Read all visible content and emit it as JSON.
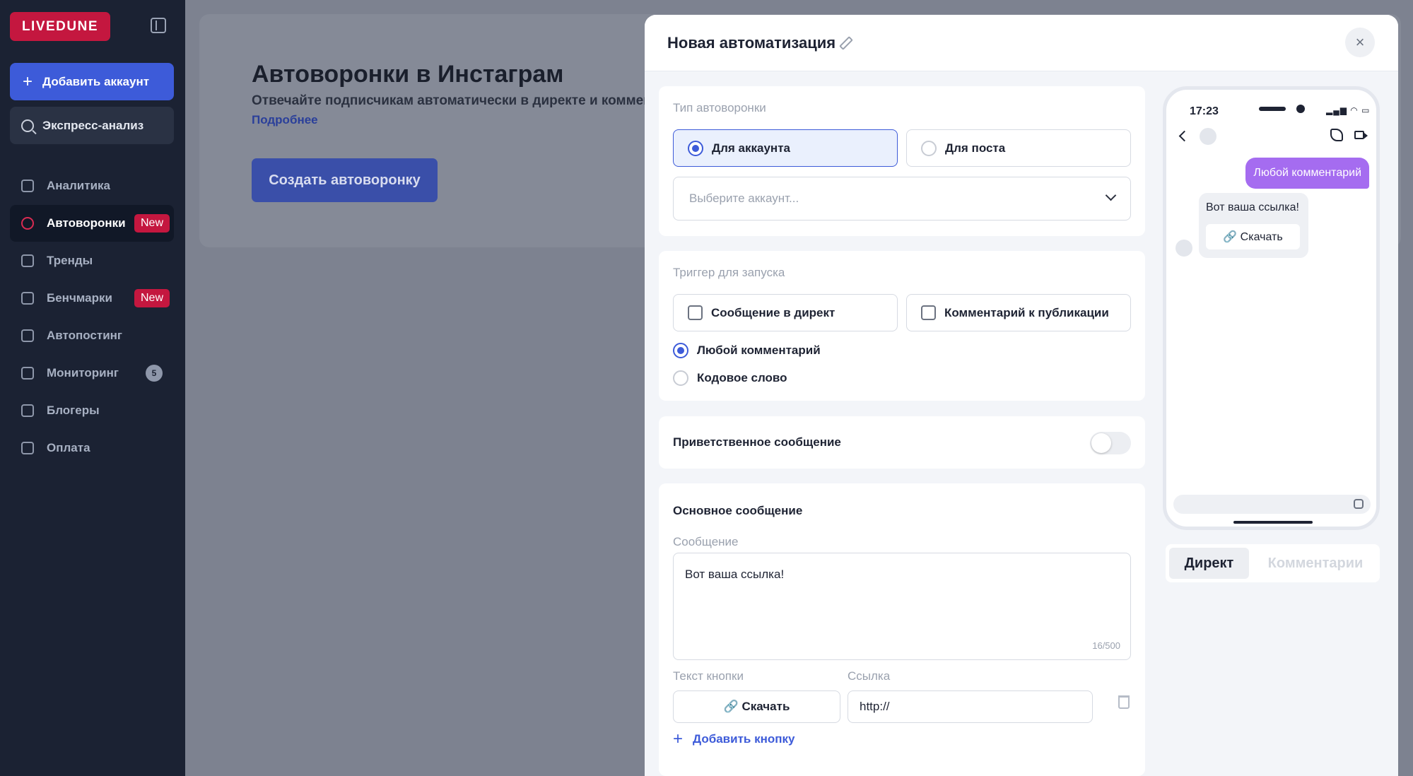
{
  "sidebar": {
    "logo": "LIVEDUNE",
    "add_account": "Добавить аккаунт",
    "express": "Экспресс-анализ",
    "items": [
      {
        "label": "Аналитика"
      },
      {
        "label": "Автоворонки",
        "badge": "New"
      },
      {
        "label": "Тренды"
      },
      {
        "label": "Бенчмарки",
        "badge": "New"
      },
      {
        "label": "Автопостинг"
      },
      {
        "label": "Мониторинг",
        "count": "5"
      },
      {
        "label": "Блогеры"
      },
      {
        "label": "Оплата"
      }
    ]
  },
  "main": {
    "title": "Автоворонки в Инстаграм",
    "description": "Отвечайте подписчикам автоматически в директе и комментариях",
    "more_link": "Подробнее",
    "create_button": "Создать автоворонку"
  },
  "modal": {
    "title": "Новая автоматизация",
    "close": "×",
    "type_section": {
      "label": "Тип автоворонки",
      "options": [
        "Для аккаунта",
        "Для поста"
      ],
      "selected": "Для аккаунта",
      "account_placeholder": "Выберите аккаунт..."
    },
    "trigger_section": {
      "label": "Триггер для запуска",
      "checkboxes": [
        "Сообщение в директ",
        "Комментарий к публикации"
      ],
      "radios": [
        "Любой комментарий",
        "Кодовое слово"
      ],
      "selected_radio": "Любой комментарий"
    },
    "welcome_section": {
      "label": "Приветственное сообщение",
      "enabled": false
    },
    "main_message": {
      "title": "Основное сообщение",
      "message_label": "Сообщение",
      "message_value": "Вот ваша ссылка!",
      "counter": "16/500",
      "button_text_label": "Текст кнопки",
      "link_label": "Ссылка",
      "button_text_value": "🔗 Скачать",
      "link_value": "http://",
      "add_button": "Добавить кнопку"
    }
  },
  "preview": {
    "time": "17:23",
    "status": "▂▄▆ ◠ ▭",
    "outgoing": "Любой комментарий",
    "incoming_text": "Вот ваша ссылка!",
    "incoming_button": "🔗 Скачать",
    "tabs": [
      "Директ",
      "Комментарии"
    ],
    "active_tab": "Директ"
  },
  "colors": {
    "brand": "#c4173f",
    "accent": "#3d5bd9",
    "bubble": "#a56cf0"
  }
}
